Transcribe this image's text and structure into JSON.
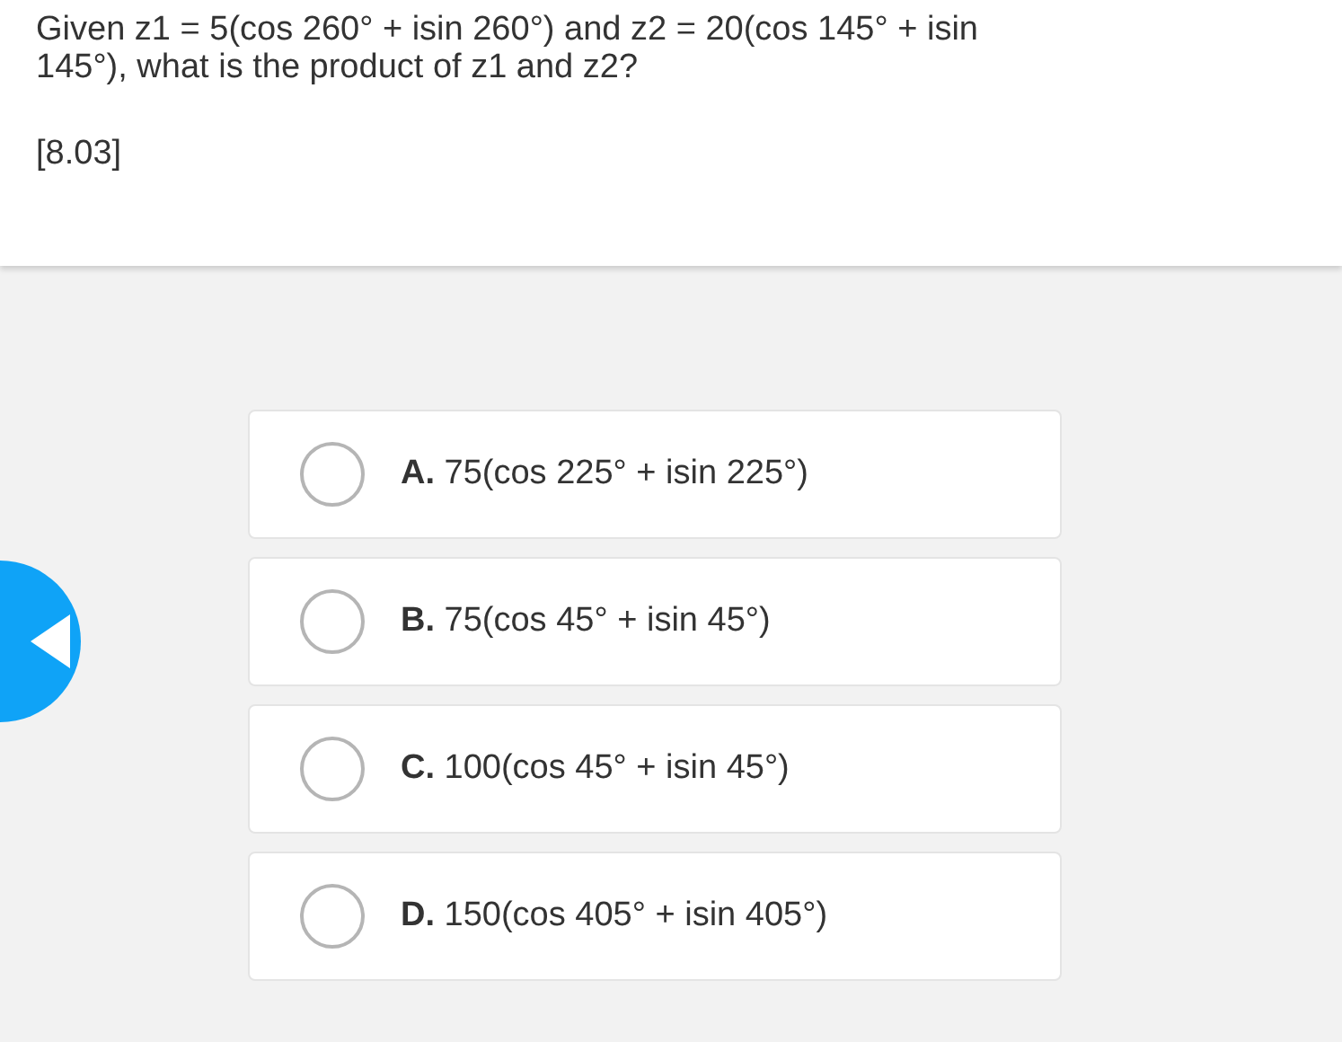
{
  "question": {
    "text": "Given z1 = 5(cos 260° + isin 260°) and z2 = 20(cos 145° + isin 145°), what is the product of z1 and z2?",
    "code": "[8.03]"
  },
  "options": [
    {
      "label": "**A.** 75(cos 225° + isin 225°)",
      "selected": false
    },
    {
      "label": "**B.** 75(cos 45° + isin 45°)",
      "selected": false
    },
    {
      "label": "**C.** 100(cos 45° + isin 45°)",
      "selected": false
    },
    {
      "label": "**D.** 150(cos 405° + isin 405°)",
      "selected": false
    }
  ]
}
